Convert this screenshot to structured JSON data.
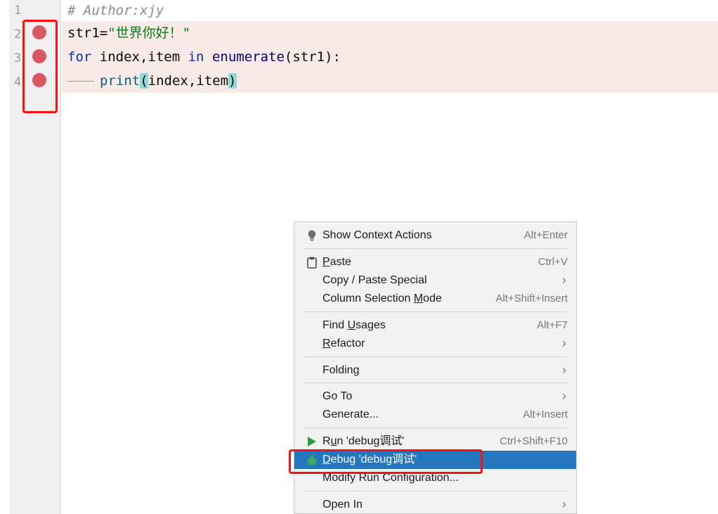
{
  "editor": {
    "line_numbers": [
      "1",
      "2",
      "3",
      "4"
    ],
    "line1": {
      "comment": "# Author:xjy"
    },
    "line2": {
      "name": "str1",
      "eq": "=",
      "string": "\"世界你好！\""
    },
    "line3": {
      "kw_for": "for",
      "vars": " index,item ",
      "kw_in": "in",
      "fn": " enumerate",
      "args": "(str1):"
    },
    "line4": {
      "fn": "print",
      "open": "(",
      "args": "index,item",
      "close": ")"
    },
    "breakpoint_color": "#db5860",
    "highlight_color": "#faeae7"
  },
  "menu": {
    "show_context_actions": {
      "label": "Show Context Actions",
      "shortcut": "Alt+Enter",
      "icon": "lightbulb-icon"
    },
    "paste": {
      "pre": "",
      "u": "P",
      "post": "aste",
      "shortcut": "Ctrl+V",
      "icon": "clipboard-icon"
    },
    "copy_paste_special": {
      "label": "Copy / Paste Special",
      "arrow": "›"
    },
    "column_selection_mode": {
      "pre": "Column Selection ",
      "u": "M",
      "post": "ode",
      "shortcut": "Alt+Shift+Insert"
    },
    "find_usages": {
      "pre": "Find ",
      "u": "U",
      "post": "sages",
      "shortcut": "Alt+F7"
    },
    "refactor": {
      "pre": "",
      "u": "R",
      "post": "efactor",
      "arrow": "›"
    },
    "folding": {
      "label": "Folding",
      "arrow": "›"
    },
    "go_to": {
      "label": "Go To",
      "arrow": "›"
    },
    "generate": {
      "label": "Generate...",
      "shortcut": "Alt+Insert"
    },
    "run": {
      "pre": "R",
      "u": "u",
      "post": "n 'debug调试'",
      "shortcut": "Ctrl+Shift+F10",
      "icon": "run-triangle-icon"
    },
    "debug": {
      "pre": "",
      "u": "D",
      "post": "ebug 'debug调试'",
      "icon": "debug-bug-icon"
    },
    "modify_run_config": {
      "label": "Modify Run Configuration..."
    },
    "open_in": {
      "label": "Open In",
      "arrow": "›"
    },
    "selected_color": "#2675bf"
  },
  "annotation_color": "#ff1010"
}
